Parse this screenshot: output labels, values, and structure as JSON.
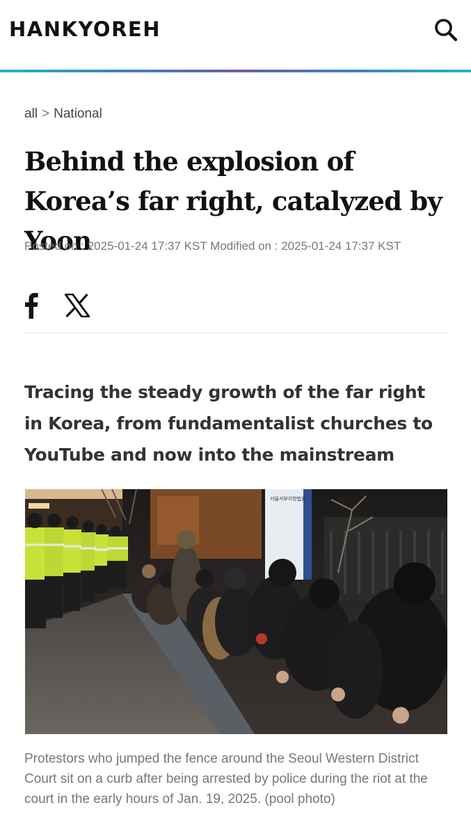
{
  "header": {
    "logo": "HANKYOREH",
    "search_icon": "search-icon",
    "accent_colors": [
      "#1fb8c4",
      "#3d83c6",
      "#6b5fb4"
    ]
  },
  "breadcrumb": {
    "root": "all",
    "separator": ">",
    "section": "National"
  },
  "article": {
    "headline": "Behind the explosion of Korea’s far right, catalyzed by Yoon",
    "meta": "Posted on : 2025-01-24 17:37 KST Modified on : 2025-01-24 17:37 KST",
    "share": {
      "facebook_icon": "facebook-icon",
      "x_icon": "x-icon"
    },
    "subtitle": "Tracing the steady growth of the far right in Korea, from fundamentalist churches to YouTube and now into the mainstream",
    "photo": {
      "sign_text": "서울서부지방법원",
      "caption": "Protestors who jumped the fence around the Seoul Western District Court sit on a curb after being arrested by police during the riot at the court in the early hours of Jan. 19, 2025. (pool photo)"
    }
  }
}
